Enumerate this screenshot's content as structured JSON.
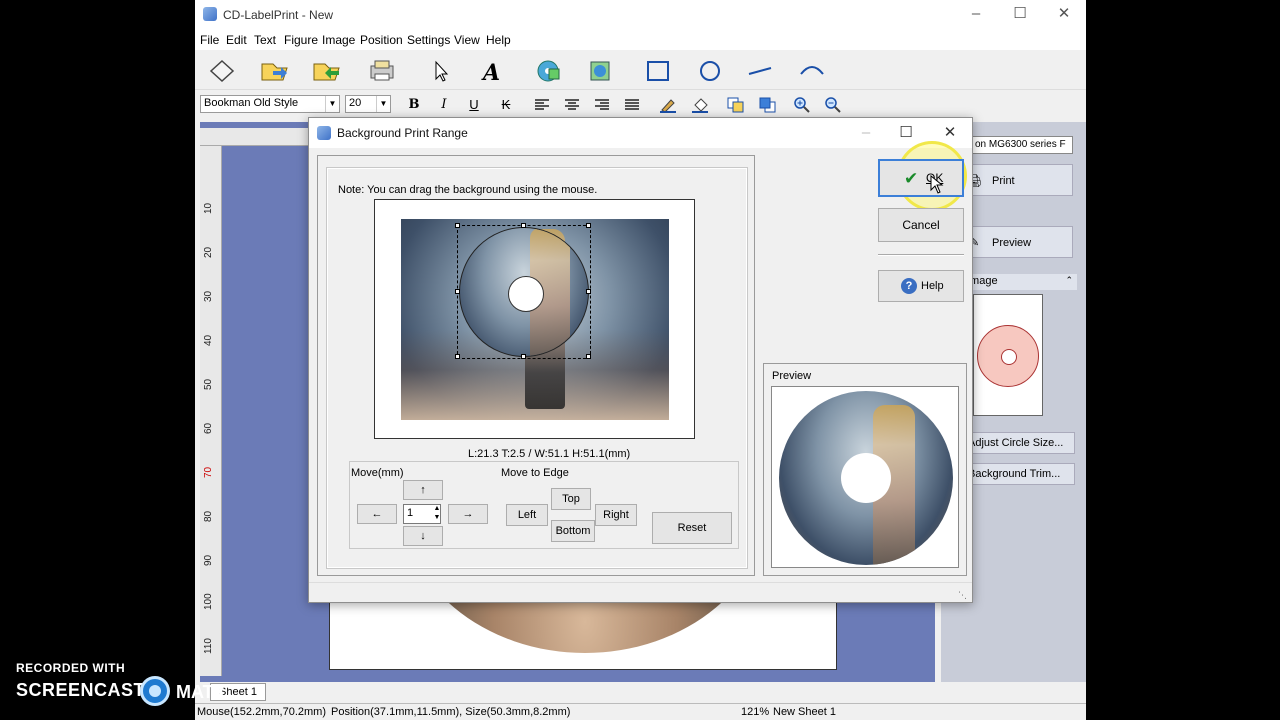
{
  "app": {
    "title": "CD-LabelPrint - New",
    "menus": [
      "File",
      "Edit",
      "Text",
      "Figure",
      "Image",
      "Position",
      "Settings",
      "View",
      "Help"
    ],
    "font_name": "Bookman Old Style",
    "font_size": "20",
    "format_buttons": [
      "B",
      "I",
      "U",
      "K"
    ],
    "sheet_tab": "Sheet 1",
    "ruler_left": [
      "10",
      "20",
      "30",
      "40",
      "50",
      "60",
      "70",
      "80",
      "90",
      "100",
      "110"
    ]
  },
  "right_panel": {
    "printer": "on MG6300 series F",
    "print_label": "Print",
    "preview_label": "Preview",
    "image_header": "Image",
    "adjust_circle": "Adjust Circle Size...",
    "background_trim": "Background Trim..."
  },
  "status": {
    "mouse": "Mouse(152.2mm,70.2mm)",
    "position": "Position(37.1mm,11.5mm), Size(50.3mm,8.2mm)",
    "zoom": "121%",
    "sheet": "New Sheet 1"
  },
  "dialog": {
    "title": "Background Print Range",
    "note": "Note: You can drag the background using the mouse.",
    "coords": "L:21.3 T:2.5 / W:51.1 H:51.1(mm)",
    "move_label": "Move(mm)",
    "move_to_edge_label": "Move to Edge",
    "arrow_up": "↑",
    "arrow_down": "↓",
    "arrow_left": "←",
    "arrow_right": "→",
    "step_value": "1",
    "top": "Top",
    "bottom": "Bottom",
    "left": "Left",
    "right": "Right",
    "reset": "Reset",
    "ok": "OK",
    "cancel": "Cancel",
    "help": "Help",
    "preview": "Preview"
  },
  "watermark": {
    "line1": "RECORDED WITH",
    "line2": "SCREENCAST",
    "line3": "MATIC"
  }
}
